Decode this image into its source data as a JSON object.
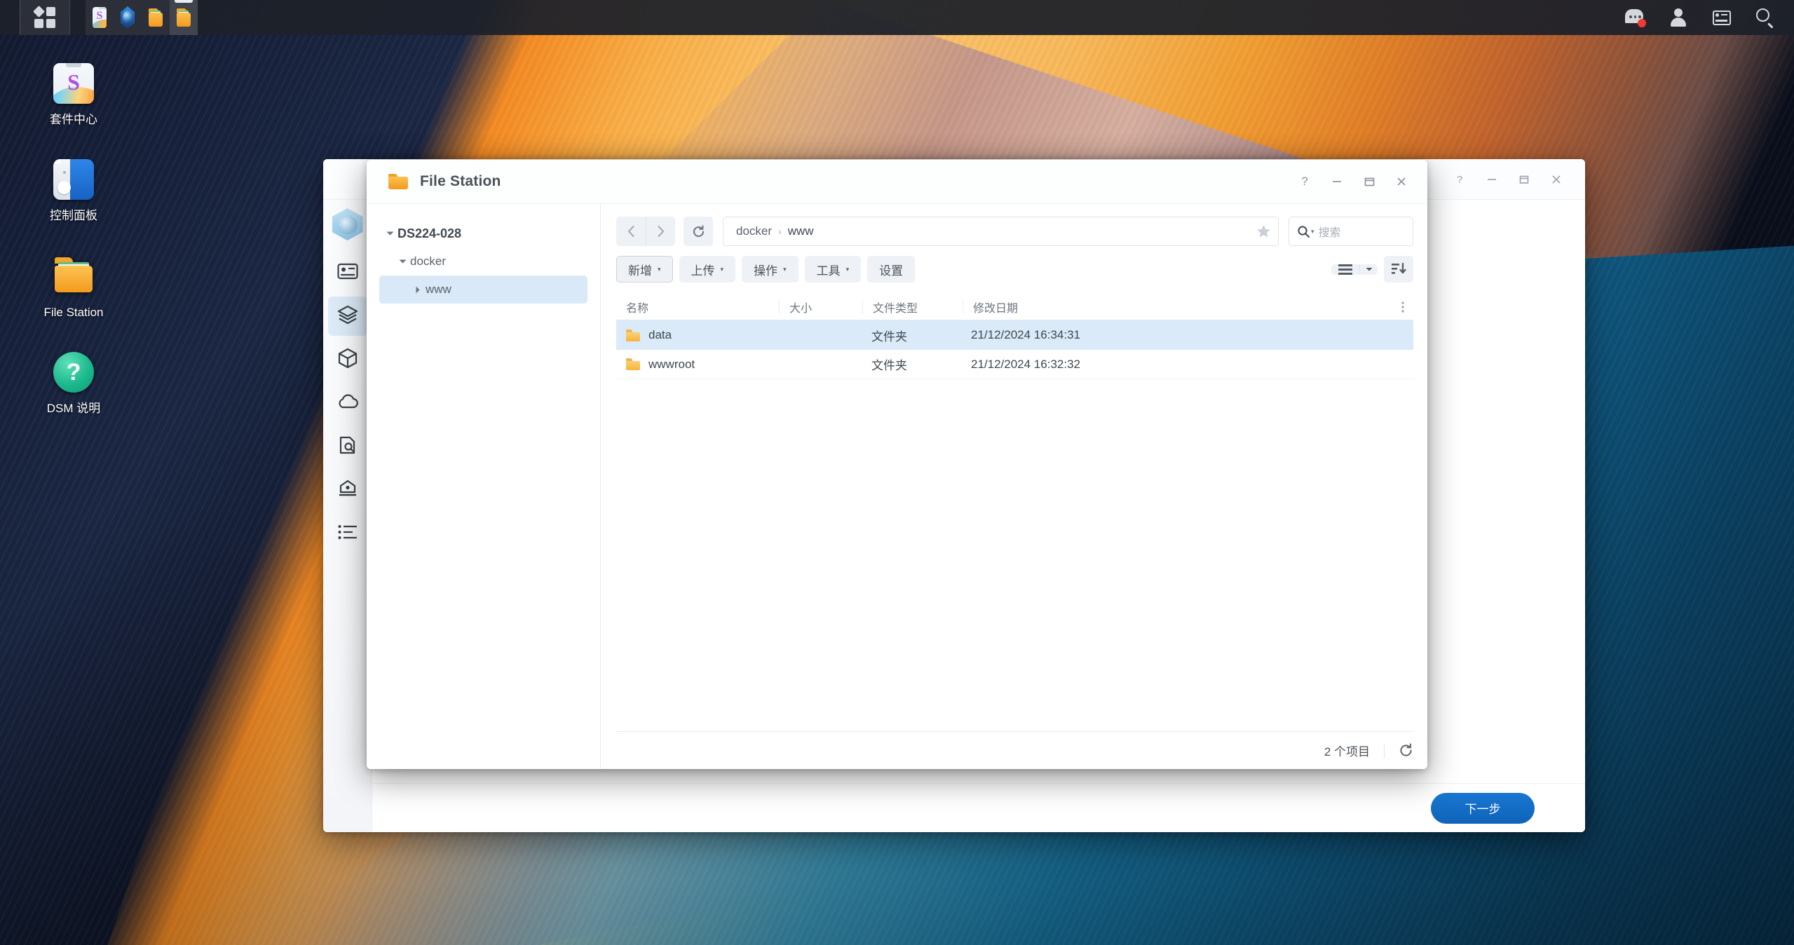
{
  "taskbar": {
    "main_menu_label": "主选单",
    "apps": [
      {
        "name": "package-center",
        "icon": "package-center-icon",
        "active": false
      },
      {
        "name": "container-manager",
        "icon": "container-manager-icon",
        "active": false
      },
      {
        "name": "file-station",
        "icon": "folder-icon",
        "active": false
      },
      {
        "name": "file-station-2",
        "icon": "folder-icon",
        "active": true
      }
    ],
    "system_icons": [
      {
        "name": "notifications-icon",
        "badge": true
      },
      {
        "name": "user-account-icon",
        "badge": false
      },
      {
        "name": "widgets-icon",
        "badge": false
      },
      {
        "name": "search-icon",
        "badge": false
      }
    ]
  },
  "desktop_icons": [
    {
      "label": "套件中心",
      "icon": "package-center-icon"
    },
    {
      "label": "控制面板",
      "icon": "control-panel-icon"
    },
    {
      "label": "File Station",
      "icon": "file-station-icon"
    },
    {
      "label": "DSM 说明",
      "icon": "dsm-help-icon"
    }
  ],
  "background_window": {
    "rail_items": [
      {
        "name": "overview",
        "icon": "overview-icon",
        "active": false
      },
      {
        "name": "project",
        "icon": "layers-icon",
        "active": true
      },
      {
        "name": "container",
        "icon": "cube-icon",
        "active": false
      },
      {
        "name": "image",
        "icon": "cloud-icon",
        "active": false
      },
      {
        "name": "registry",
        "icon": "registry-search-icon",
        "active": false
      },
      {
        "name": "network",
        "icon": "network-icon",
        "active": false
      },
      {
        "name": "log",
        "icon": "log-list-icon",
        "active": false
      }
    ],
    "next_button": "下一步",
    "window_controls": [
      "?",
      "—",
      "▭",
      "✕"
    ]
  },
  "file_station": {
    "title": "File Station",
    "window_controls": [
      "?",
      "—",
      "▭",
      "✕"
    ],
    "tree": [
      {
        "label": "DS224-028",
        "level": 0,
        "expanded": true,
        "selected": false
      },
      {
        "label": "docker",
        "level": 1,
        "expanded": true,
        "selected": false
      },
      {
        "label": "www",
        "level": 2,
        "expanded": false,
        "selected": true
      }
    ],
    "nav": {
      "back_label": "后退",
      "forward_label": "前进",
      "refresh_label": "重新整理",
      "breadcrumbs": [
        "docker",
        "www"
      ],
      "breadcrumb_separator": "›",
      "favorite_label": "加入我的最爱",
      "search_placeholder": "搜索"
    },
    "toolbar": {
      "buttons": [
        {
          "label": "新增",
          "dropdown": true,
          "outlined": true
        },
        {
          "label": "上传",
          "dropdown": true,
          "outlined": false
        },
        {
          "label": "操作",
          "dropdown": true,
          "outlined": false
        },
        {
          "label": "工具",
          "dropdown": true,
          "outlined": false
        },
        {
          "label": "设置",
          "dropdown": false,
          "outlined": false
        }
      ],
      "view_mode_label": "检视模式",
      "view_mode_caret": "▾",
      "sort_label": "排序"
    },
    "table": {
      "columns": [
        "名称",
        "大小",
        "文件类型",
        "修改日期"
      ],
      "more_label": "更多栏位",
      "rows": [
        {
          "name": "data",
          "size": "",
          "type": "文件夹",
          "modified": "21/12/2024 16:34:31",
          "selected": true
        },
        {
          "name": "wwwroot",
          "size": "",
          "type": "文件夹",
          "modified": "21/12/2024 16:32:32",
          "selected": false
        }
      ]
    },
    "status": {
      "item_count": "2 个项目",
      "refresh_label": "重新整理"
    }
  },
  "colors": {
    "accent_blue": "#1877d2",
    "selection_blue": "#dbeaf8",
    "taskbar_bg": "#1d2129",
    "folder_orange": "#f6b53c",
    "badge_red": "#f4392f"
  }
}
